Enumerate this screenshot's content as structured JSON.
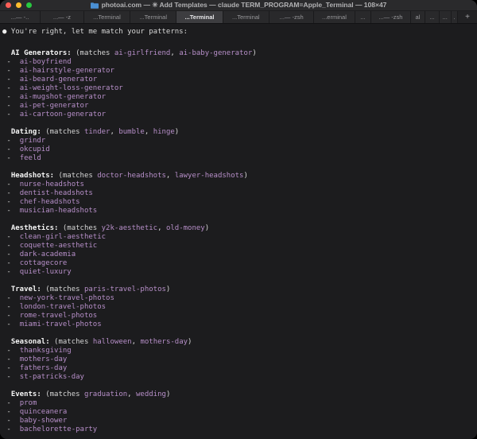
{
  "window": {
    "title": "photoai.com — ✳ Add Templates — claude TERM_PROGRAM=Apple_Terminal — 108×47",
    "folder_icon_color": "#4a8fd3",
    "traffic_light_colors": {
      "close": "#ff5f57",
      "minimize": "#febc2e",
      "zoom": "#28c840"
    }
  },
  "tabs": {
    "new_tab_label": "+",
    "items": [
      {
        "label": "...— -..",
        "active": false,
        "weight": 56
      },
      {
        "label": "...— -z",
        "active": false,
        "weight": 60
      },
      {
        "label": "...Terminal",
        "active": false,
        "weight": 64
      },
      {
        "label": "...Terminal",
        "active": false,
        "weight": 64
      },
      {
        "label": "...Terminal",
        "active": true,
        "weight": 64
      },
      {
        "label": "...Terminal",
        "active": false,
        "weight": 64
      },
      {
        "label": "...— -zsh",
        "active": false,
        "weight": 62
      },
      {
        "label": "...erminal",
        "active": false,
        "weight": 56
      },
      {
        "label": "...",
        "active": false,
        "weight": 22
      },
      {
        "label": "...— -zsh",
        "active": false,
        "weight": 54
      },
      {
        "label": "al",
        "active": false,
        "weight": 20
      },
      {
        "label": "...",
        "active": false,
        "weight": 18
      },
      {
        "label": "...",
        "active": false,
        "weight": 16
      },
      {
        "label": ".",
        "active": false,
        "weight": 8
      }
    ]
  },
  "terminal": {
    "intro_bullet": "●",
    "intro": "You're right, let me match your patterns:",
    "matches_label": "(matches",
    "close_paren": ")",
    "list_marker": "-",
    "text_color": "#dedede",
    "accent_purple": "#b78fc9",
    "background": "#1c1c1e",
    "sections": [
      {
        "title": "AI Generators:",
        "matches": [
          "ai-girlfriend",
          "ai-baby-generator"
        ],
        "items": [
          "ai-boyfriend",
          "ai-hairstyle-generator",
          "ai-beard-generator",
          "ai-weight-loss-generator",
          "ai-mugshot-generator",
          "ai-pet-generator",
          "ai-cartoon-generator"
        ]
      },
      {
        "title": "Dating:",
        "matches": [
          "tinder",
          "bumble",
          "hinge"
        ],
        "items": [
          "grindr",
          "okcupid",
          "feeld"
        ]
      },
      {
        "title": "Headshots:",
        "matches": [
          "doctor-headshots",
          "lawyer-headshots"
        ],
        "items": [
          "nurse-headshots",
          "dentist-headshots",
          "chef-headshots",
          "musician-headshots"
        ]
      },
      {
        "title": "Aesthetics:",
        "matches": [
          "y2k-aesthetic",
          "old-money"
        ],
        "items": [
          "clean-girl-aesthetic",
          "coquette-aesthetic",
          "dark-academia",
          "cottagecore",
          "quiet-luxury"
        ]
      },
      {
        "title": "Travel:",
        "matches": [
          "paris-travel-photos"
        ],
        "items": [
          "new-york-travel-photos",
          "london-travel-photos",
          "rome-travel-photos",
          "miami-travel-photos"
        ]
      },
      {
        "title": "Seasonal:",
        "matches": [
          "halloween",
          "mothers-day"
        ],
        "items": [
          "thanksgiving",
          "mothers-day",
          "fathers-day",
          "st-patricks-day"
        ]
      },
      {
        "title": "Events:",
        "matches": [
          "graduation",
          "wedding"
        ],
        "items": [
          "prom",
          "quinceanera",
          "baby-shower",
          "bachelorette-party"
        ]
      }
    ]
  }
}
